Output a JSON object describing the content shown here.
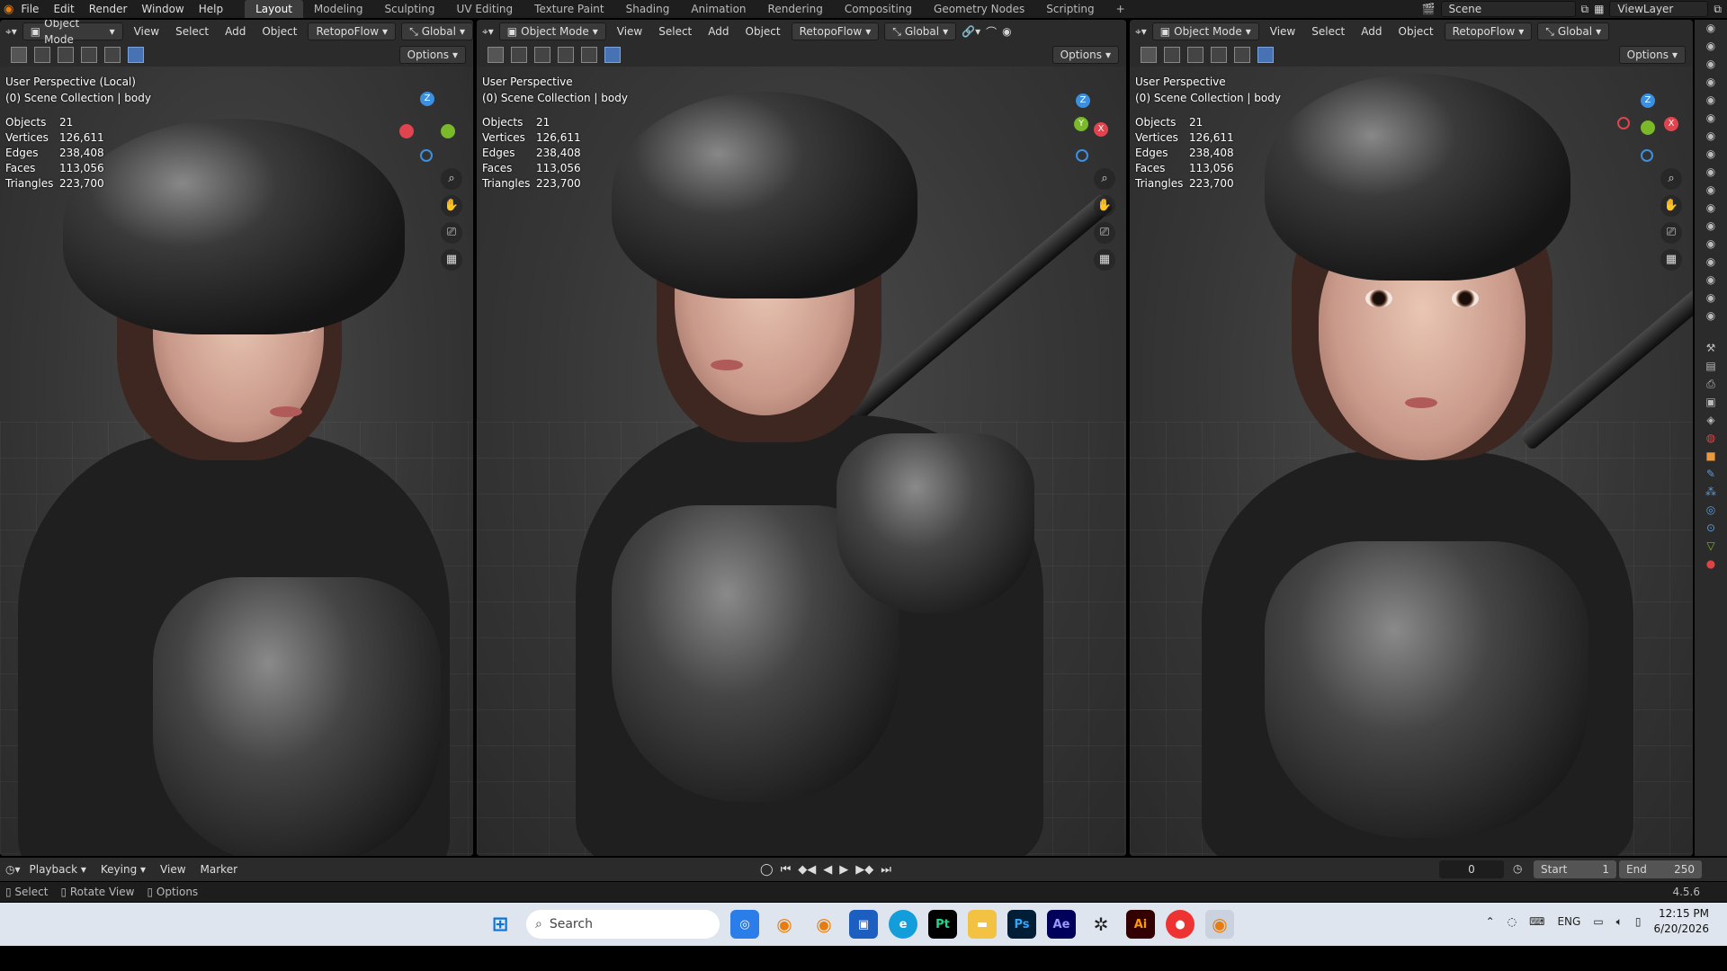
{
  "menu": [
    "File",
    "Edit",
    "Render",
    "Window",
    "Help"
  ],
  "workspaces": [
    "Layout",
    "Modeling",
    "Sculpting",
    "UV Editing",
    "Texture Paint",
    "Shading",
    "Animation",
    "Rendering",
    "Compositing",
    "Geometry Nodes",
    "Scripting"
  ],
  "active_workspace": "Layout",
  "top_right": {
    "scene": "Scene",
    "view_layer": "ViewLayer"
  },
  "viewport_header": {
    "mode": "Object Mode",
    "menus": [
      "View",
      "Select",
      "Add",
      "Object"
    ],
    "addon": "RetopoFlow",
    "orientation": "Global",
    "options": "Options"
  },
  "viewports": [
    {
      "perspective": "User Perspective (Local)",
      "collection": "(0) Scene Collection | body"
    },
    {
      "perspective": "User Perspective",
      "collection": "(0) Scene Collection | body"
    },
    {
      "perspective": "User Perspective",
      "collection": "(0) Scene Collection | body"
    }
  ],
  "stats": {
    "labels": [
      "Objects",
      "Vertices",
      "Edges",
      "Faces",
      "Triangles"
    ],
    "values": [
      "21",
      "126,611",
      "238,408",
      "113,056",
      "223,700"
    ]
  },
  "gizmo": {
    "z": "Z",
    "y": "Y",
    "x": "X"
  },
  "timeline": {
    "menus": [
      "Playback",
      "Keying",
      "View",
      "Marker"
    ],
    "current_frame": "0",
    "start_label": "Start",
    "start_value": "1",
    "end_label": "End",
    "end_value": "250"
  },
  "statusbar": {
    "select": "Select",
    "rotate": "Rotate View",
    "options": "Options",
    "version": "4.5.6"
  },
  "taskbar": {
    "search_placeholder": "Search",
    "lang": "ENG",
    "time": "12:15 PM",
    "date": "6/20/2026",
    "apps": [
      "Pt",
      "Ps",
      "Ae",
      "Ai"
    ]
  },
  "colors": {
    "accent": "#4772b3",
    "axis_x": "#e0444e",
    "axis_y": "#7ab929",
    "axis_z": "#3d8fe0"
  }
}
